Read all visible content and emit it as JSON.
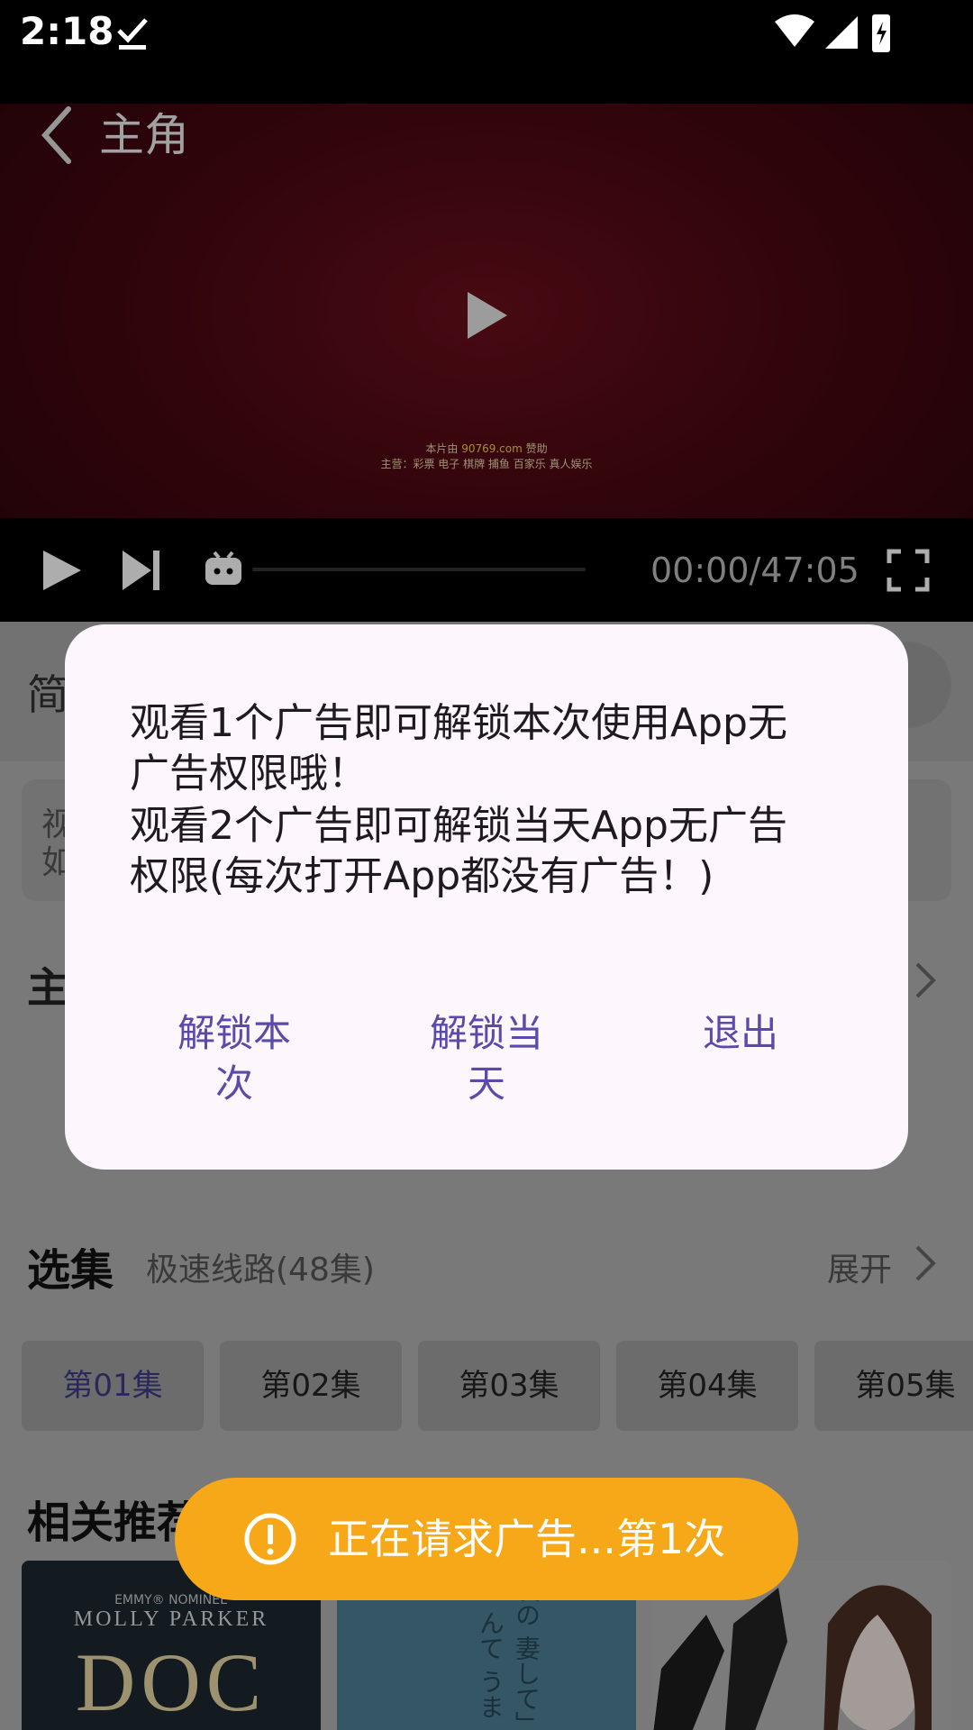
{
  "status_bar": {
    "time": "2:18"
  },
  "player": {
    "title": "主角",
    "sponsor_prefix": "本片由",
    "sponsor_url": "90769.com",
    "sponsor_suffix": "赞助",
    "sponsor_line2": "主营：彩票 电子 棋牌 捕鱼 百家乐 真人娱乐",
    "time": "00:00/47:05",
    "progress": 0
  },
  "content": {
    "tab_partial": "简",
    "desc_line1": "视",
    "desc_line2": "如",
    "section_partial": "主",
    "episodes_title": "选集",
    "episodes_route": "极速线路(48集)",
    "episodes_expand": "展开",
    "episodes": [
      "第01集",
      "第02集",
      "第03集",
      "第04集",
      "第05集"
    ],
    "related_title": "相关推荐",
    "poster1_small": "EMMY® NOMINEE",
    "poster1_name": "MOLLY PARKER",
    "poster1_title": "DOC",
    "poster2_text": "友の 妻して」に んて うまで"
  },
  "dialog": {
    "line1": "观看1个广告即可解锁本次使用App无",
    "line2": "广告权限哦！",
    "line3": "观看2个广告即可解锁当天App无广告",
    "line4": "权限(每次打开App都没有广告！)",
    "btn_once_1": "解锁本",
    "btn_once_2": "次",
    "btn_day_1": "解锁当",
    "btn_day_2": "天",
    "btn_exit": "退出"
  },
  "toast": {
    "text": "正在请求广告...第1次"
  },
  "colors": {
    "accent": "#5b4aa7",
    "toast": "#f6a818",
    "active_episode": "#3e3c85"
  }
}
